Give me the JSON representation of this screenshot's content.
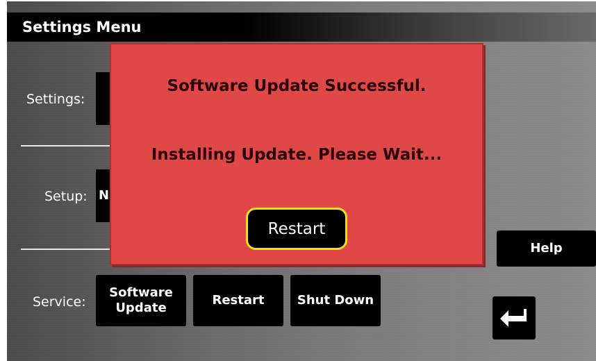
{
  "header": {
    "title": "Settings Menu"
  },
  "rows": {
    "settings_label": "Settings:",
    "setup_label": "Setup:",
    "setup_partial_text": "N",
    "service_label": "Service:"
  },
  "service_buttons": {
    "software_update_line1": "Software",
    "software_update_line2": "Update",
    "restart": "Restart",
    "shut_down": "Shut Down"
  },
  "side": {
    "help": "Help",
    "back_icon": "return-arrow-icon"
  },
  "dialog": {
    "line1": "Software Update Successful.",
    "line2": "Installing Update. Please Wait...",
    "restart_button": "Restart",
    "background_color": "#e04848",
    "button_border_color": "#f2e21b"
  }
}
